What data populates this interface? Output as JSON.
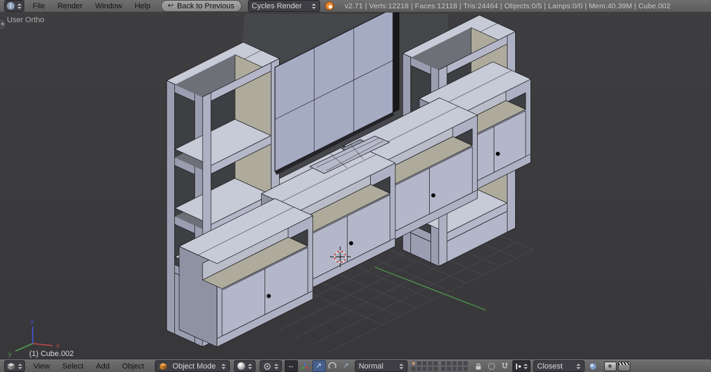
{
  "top_bar": {
    "menus": [
      "File",
      "Render",
      "Window",
      "Help"
    ],
    "back_button": "Back to Previous",
    "engine": "Cycles Render",
    "stats": "v2.71 | Verts:12218 | Faces:12118 | Tris:24464 | Objects:0/5 | Lamps:0/0 | Mem:40.39M | Cube.002"
  },
  "viewport": {
    "view_label": "User Ortho",
    "active_object": "(1) Cube.002",
    "axis": {
      "x": "x",
      "y": "y",
      "z": "z"
    }
  },
  "bottom_bar": {
    "menus": [
      "View",
      "Select",
      "Add",
      "Object"
    ],
    "mode": "Object Mode",
    "orientation": "Normal",
    "snap_target": "Closest"
  },
  "colors": {
    "viewport_bg": "#3a3a3c",
    "face_front": "#adb1c3",
    "face_top": "#c7cad7",
    "face_side": "#9a9eb0",
    "face_door": "#b4b7c9",
    "interior_beige": "#aeab9c",
    "shadow": "#6e7078",
    "opening_dark": "#3e3f43",
    "back_panel": "#46474b",
    "edge": "#141417",
    "grid_line": "#464748",
    "axis_green": "#4f9e4f",
    "axis_red": "#c04848",
    "axis_blue": "#4754d8",
    "cursor_red": "#cc4444",
    "knob": "#0a0a0c",
    "accent_orange": "#e8862d"
  }
}
